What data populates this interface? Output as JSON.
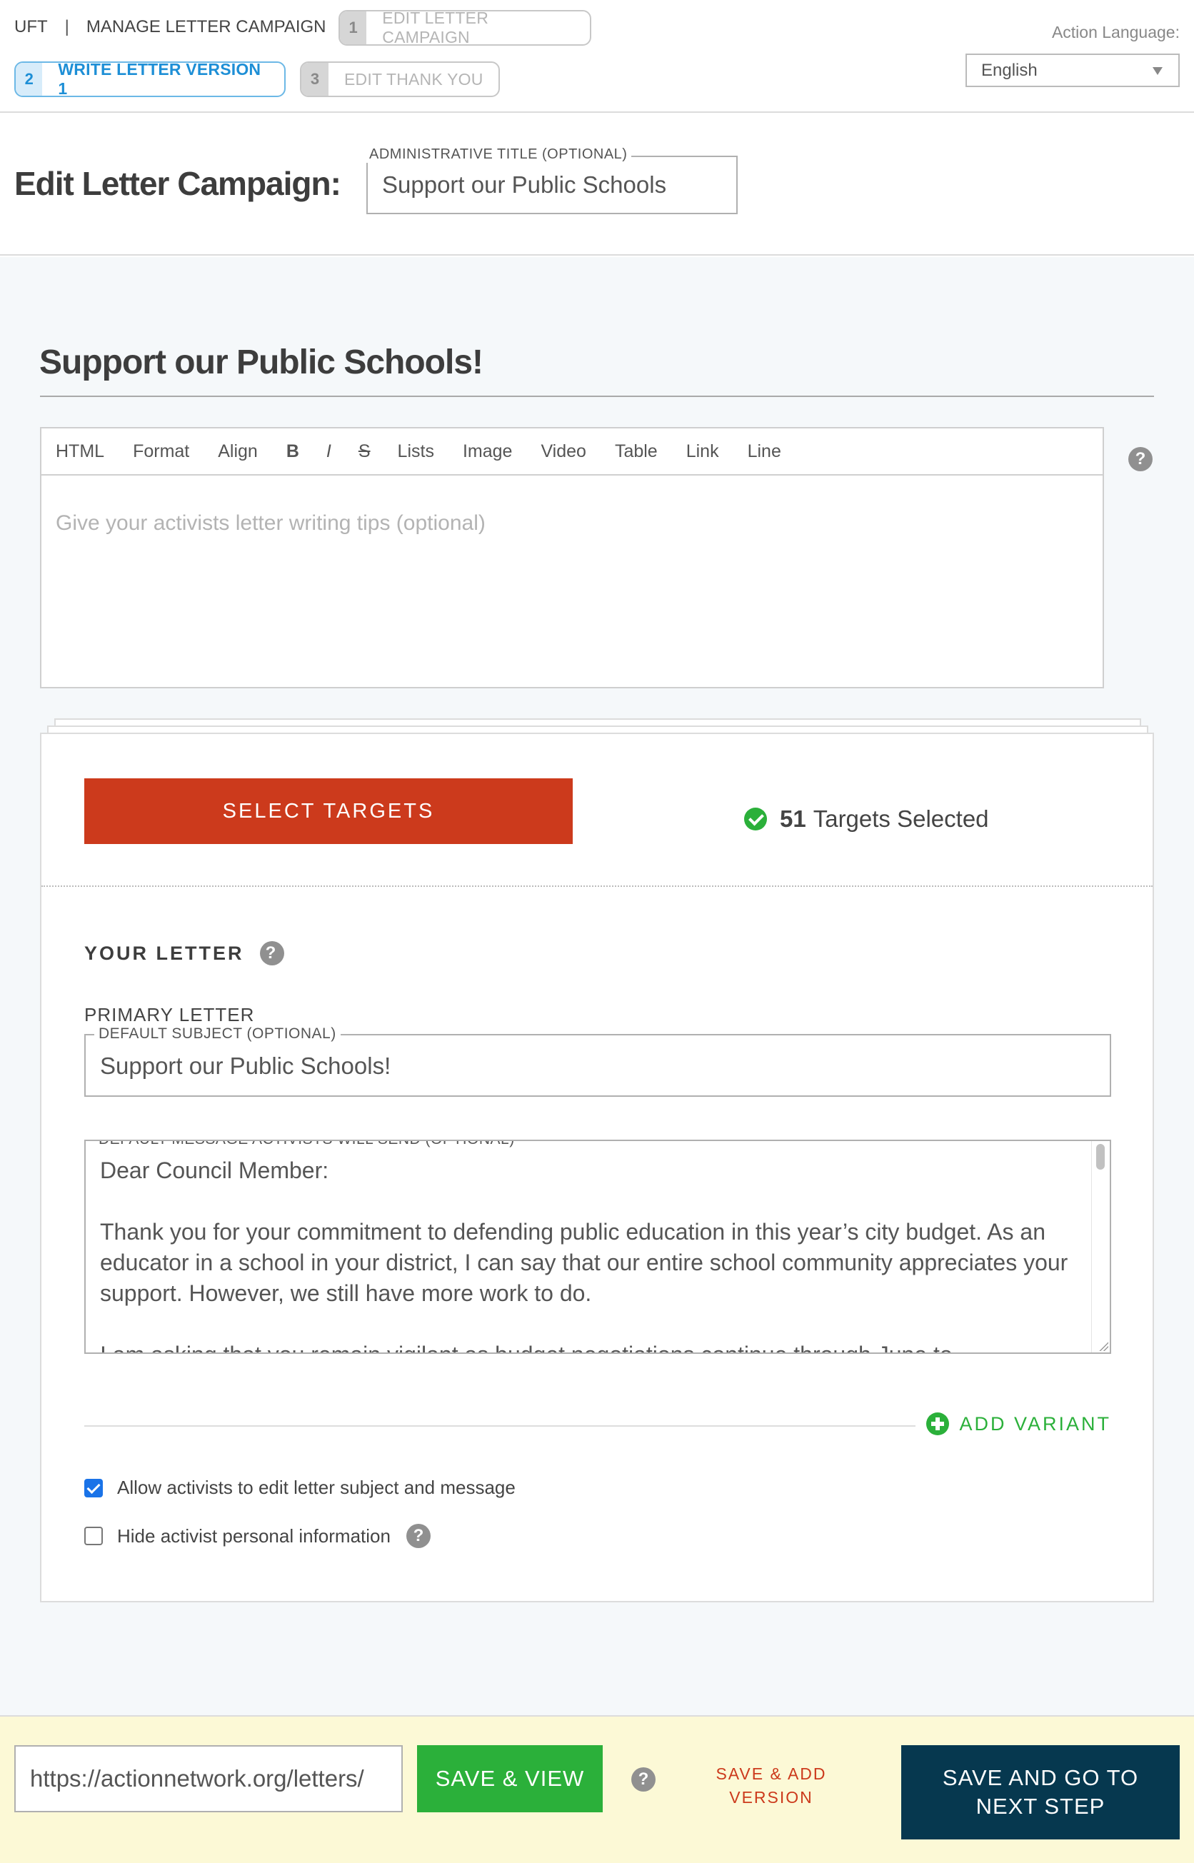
{
  "nav": {
    "org": "UFT",
    "separator": "|",
    "section": "MANAGE LETTER CAMPAIGN",
    "steps": [
      {
        "number": "1",
        "label": "EDIT LETTER CAMPAIGN",
        "active": false
      },
      {
        "number": "2",
        "label": "WRITE LETTER VERSION 1",
        "active": true
      },
      {
        "number": "3",
        "label": "EDIT THANK YOU",
        "active": false
      }
    ],
    "language_label": "Action Language:",
    "language_value": "English"
  },
  "header": {
    "title": "Edit Letter Campaign:",
    "admin_title_label": "ADMINISTRATIVE TITLE (OPTIONAL)",
    "admin_title_value": "Support our Public Schools"
  },
  "main": {
    "section_title": "Support our Public Schools!",
    "editor": {
      "toolbar": [
        "HTML",
        "Format",
        "Align",
        "B",
        "I",
        "S",
        "Lists",
        "Image",
        "Video",
        "Table",
        "Link",
        "Line"
      ],
      "placeholder": "Give your activists letter writing tips (optional)"
    },
    "targets": {
      "button_label": "SELECT TARGETS",
      "count": "51",
      "status_text": "Targets Selected"
    },
    "letter": {
      "heading": "YOUR LETTER",
      "primary_label": "PRIMARY LETTER",
      "subject_label": "DEFAULT SUBJECT (OPTIONAL)",
      "subject_value": "Support our Public Schools!",
      "message_label": "DEFAULT MESSAGE ACTIVISTS WILL SEND (OPTIONAL)",
      "message_value": "Dear Council Member:\n\nThank you for your commitment to defending public education in this year’s city budget. As an educator in a school in your district, I can say that our entire school community appreciates your support. However, we still have more work to do.\n\nI am asking that you remain vigilant as budget negotiations continue through June to",
      "add_variant_label": "ADD VARIANT"
    },
    "options": [
      {
        "label": "Allow activists to edit letter subject and message",
        "checked": true
      },
      {
        "label": "Hide activist personal information",
        "checked": false
      }
    ]
  },
  "footer": {
    "url_value": "https://actionnetwork.org/letters/",
    "save_view_label": "SAVE & VIEW",
    "save_add_label": "SAVE & ADD VERSION",
    "save_next_label": "SAVE AND GO TO NEXT STEP"
  },
  "colors": {
    "accent_blue": "#1e8fd6",
    "select_targets_red": "#cc3a1c",
    "success_green": "#2bb03a",
    "footer_bg": "#fcf9d6",
    "next_step_navy": "#06384f"
  }
}
